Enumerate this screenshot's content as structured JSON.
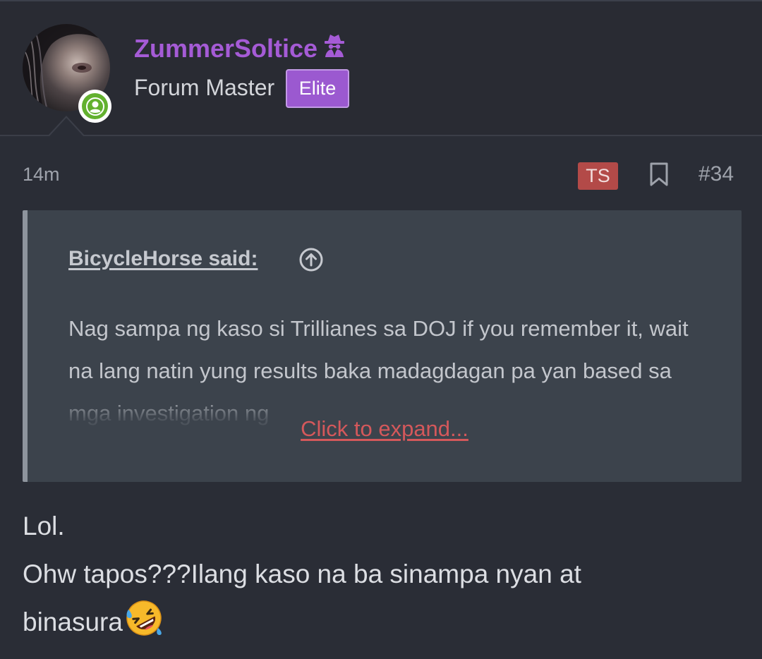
{
  "user": {
    "username": "ZummerSoltice",
    "title": "Forum Master",
    "badge": "Elite",
    "username_color": "#a55bd6",
    "badge_color": "#9b59d0",
    "online_status": "online",
    "username_icon": "spy-icon"
  },
  "post": {
    "time": "14m",
    "ts_badge": "TS",
    "ts_badge_color": "#b34a48",
    "number": "#34",
    "bookmark_icon": "bookmark-icon"
  },
  "quote": {
    "author": "BicycleHorse said:",
    "jump_icon": "arrow-up-circle-icon",
    "text": "Nag sampa ng kaso si Trillianes sa DOJ if you remember it, wait na lang natin yung results baka madagdagan pa yan based sa mga investigation ng",
    "expand": "Click to expand...",
    "expand_color": "#d4585b"
  },
  "message": {
    "line1": "Lol.",
    "line2": "Ohw tapos???Ilang kaso na ba sinampa nyan at",
    "line3": "binasura",
    "emoji": "rolling-on-floor-laughing-emoji"
  }
}
